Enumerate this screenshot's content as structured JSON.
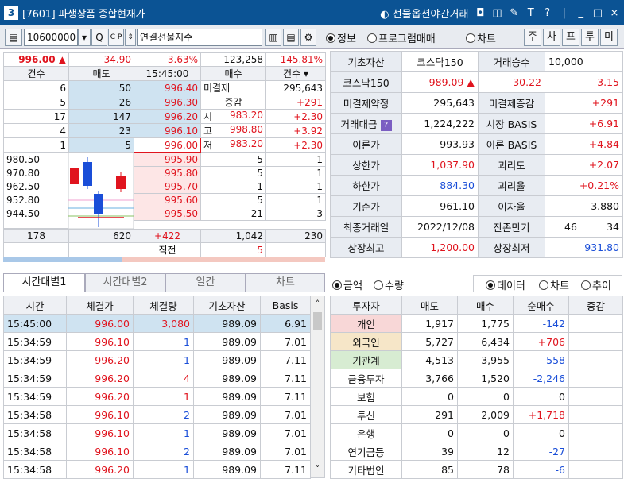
{
  "window": {
    "num": "3",
    "title": "[7601] 파생상품 종합현재가",
    "night": "선물옵션야간거래",
    "icons": [
      "◘",
      "◫",
      "✎",
      "T",
      "?",
      "|",
      "_",
      "□",
      "×"
    ]
  },
  "toolbar": {
    "code": "10600000",
    "code_suffix": "▾",
    "search": "Q",
    "name": "연결선물지수",
    "radios": [
      {
        "label": "정보",
        "on": true
      },
      {
        "label": "프로그램매매",
        "on": false
      },
      {
        "label": "차트",
        "on": false
      }
    ],
    "tabs": [
      "주",
      "차",
      "프",
      "투",
      "미"
    ]
  },
  "quote": {
    "price": "996.00 ▲",
    "change": "34.90",
    "rate": "3.63%",
    "volume": "123,258",
    "vol_rate": "145.81%"
  },
  "orderbook": {
    "headers": [
      "건수",
      "매도",
      "15:45:00",
      "매수",
      "건수"
    ],
    "asks": [
      {
        "cnt": "6",
        "qty": "50",
        "price": "996.40"
      },
      {
        "cnt": "5",
        "qty": "26",
        "price": "996.30"
      },
      {
        "cnt": "17",
        "qty": "147",
        "price": "996.20"
      },
      {
        "cnt": "4",
        "qty": "23",
        "price": "996.10"
      },
      {
        "cnt": "1",
        "qty": "5",
        "price": "996.00"
      }
    ],
    "side": [
      {
        "l": "미결제",
        "v": "295,643",
        "cls": ""
      },
      {
        "l": "증감",
        "v": "+291",
        "cls": "red"
      },
      {
        "l": "시",
        "v": "983.20",
        "d": "+2.30"
      },
      {
        "l": "고",
        "v": "998.80",
        "d": "+3.92"
      },
      {
        "l": "저",
        "v": "983.20",
        "d": "+2.30"
      }
    ],
    "chart_labels": [
      "980.50",
      "970.80",
      "962.50",
      "952.80",
      "944.50"
    ],
    "bids": [
      {
        "price": "995.90",
        "qty": "5",
        "cnt": "1"
      },
      {
        "price": "995.80",
        "qty": "5",
        "cnt": "1"
      },
      {
        "price": "995.70",
        "qty": "1",
        "cnt": "1"
      },
      {
        "price": "995.60",
        "qty": "5",
        "cnt": "1"
      },
      {
        "price": "995.50",
        "qty": "21",
        "cnt": "3"
      }
    ],
    "totals": {
      "ask_cnt": "178",
      "ask_qty": "620",
      "diff": "+422",
      "bid_qty": "1,042",
      "bid_cnt": "230"
    },
    "prev": {
      "label": "직전",
      "val": "5"
    }
  },
  "info": [
    {
      "l1": "기초자산",
      "v1": "코스닥150",
      "l2": "거래승수",
      "v2": "10,000"
    },
    {
      "l1": "코스닥150",
      "v1": "989.09 ▲",
      "x": "30.22",
      "v2": "3.15"
    },
    {
      "l1": "미결제약정",
      "v1": "295,643",
      "l2": "미결제증감",
      "v2": "+291"
    },
    {
      "l1": "거래대금",
      "v1": "1,224,222",
      "l2": "시장 BASIS",
      "v2": "+6.91"
    },
    {
      "l1": "이론가",
      "v1": "993.93",
      "l2": "이론 BASIS",
      "v2": "+4.84"
    },
    {
      "l1": "상한가",
      "v1": "1,037.90",
      "l2": "괴리도",
      "v2": "+2.07"
    },
    {
      "l1": "하한가",
      "v1": "884.30",
      "l2": "괴리율",
      "v2": "+0.21%"
    },
    {
      "l1": "기준가",
      "v1": "961.10",
      "l2": "이자율",
      "v2": "3.880"
    },
    {
      "l1": "최종거래일",
      "v1": "2022/12/08",
      "l2": "잔존만기",
      "v2a": "46",
      "v2": "34"
    },
    {
      "l1": "상장최고",
      "v1": "1,200.00",
      "l2": "상장최저",
      "v2": "931.80"
    }
  ],
  "tick_tabs": [
    "시간대별1",
    "시간대별2",
    "일간",
    "차트"
  ],
  "ticks": {
    "headers": [
      "시간",
      "체결가",
      "체결량",
      "기초자산",
      "Basis"
    ],
    "rows": [
      [
        "15:45:00",
        "996.00",
        "3,080",
        "989.09",
        "6.91"
      ],
      [
        "15:34:59",
        "996.10",
        "1",
        "989.09",
        "7.01"
      ],
      [
        "15:34:59",
        "996.20",
        "1",
        "989.09",
        "7.11"
      ],
      [
        "15:34:59",
        "996.20",
        "4",
        "989.09",
        "7.11"
      ],
      [
        "15:34:59",
        "996.20",
        "1",
        "989.09",
        "7.11"
      ],
      [
        "15:34:58",
        "996.10",
        "2",
        "989.09",
        "7.01"
      ],
      [
        "15:34:58",
        "996.10",
        "1",
        "989.09",
        "7.01"
      ],
      [
        "15:34:58",
        "996.10",
        "2",
        "989.09",
        "7.01"
      ],
      [
        "15:34:58",
        "996.20",
        "1",
        "989.09",
        "7.11"
      ]
    ]
  },
  "investor_opts": {
    "left": [
      {
        "label": "금액",
        "on": true
      },
      {
        "label": "수량",
        "on": false
      }
    ],
    "right": [
      {
        "label": "데이터",
        "on": true
      },
      {
        "label": "차트",
        "on": false
      },
      {
        "label": "추이",
        "on": false
      }
    ]
  },
  "investors": {
    "headers": [
      "투자자",
      "매도",
      "매수",
      "순매수",
      "증감"
    ],
    "rows": [
      {
        "name": "개인",
        "sell": "1,917",
        "buy": "1,775",
        "net": "-142",
        "bg": "#f8d7d7",
        "cls": "blue"
      },
      {
        "name": "외국인",
        "sell": "5,727",
        "buy": "6,434",
        "net": "+706",
        "bg": "#f6e6c8",
        "cls": "red"
      },
      {
        "name": "기관계",
        "sell": "4,513",
        "buy": "3,955",
        "net": "-558",
        "bg": "#d7ecd2",
        "cls": "blue"
      },
      {
        "name": "금융투자",
        "sell": "3,766",
        "buy": "1,520",
        "net": "-2,246",
        "bg": "",
        "cls": "blue"
      },
      {
        "name": "보험",
        "sell": "0",
        "buy": "0",
        "net": "0",
        "bg": "",
        "cls": ""
      },
      {
        "name": "투신",
        "sell": "291",
        "buy": "2,009",
        "net": "+1,718",
        "bg": "",
        "cls": "red"
      },
      {
        "name": "은행",
        "sell": "0",
        "buy": "0",
        "net": "0",
        "bg": "",
        "cls": ""
      },
      {
        "name": "연기금등",
        "sell": "39",
        "buy": "12",
        "net": "-27",
        "bg": "",
        "cls": "blue"
      },
      {
        "name": "기타법인",
        "sell": "85",
        "buy": "78",
        "net": "-6",
        "bg": "",
        "cls": "blue"
      }
    ]
  },
  "colors": {
    "title_bg": "#0b5394",
    "up": "#e0141e",
    "down": "#1a4ed8"
  }
}
